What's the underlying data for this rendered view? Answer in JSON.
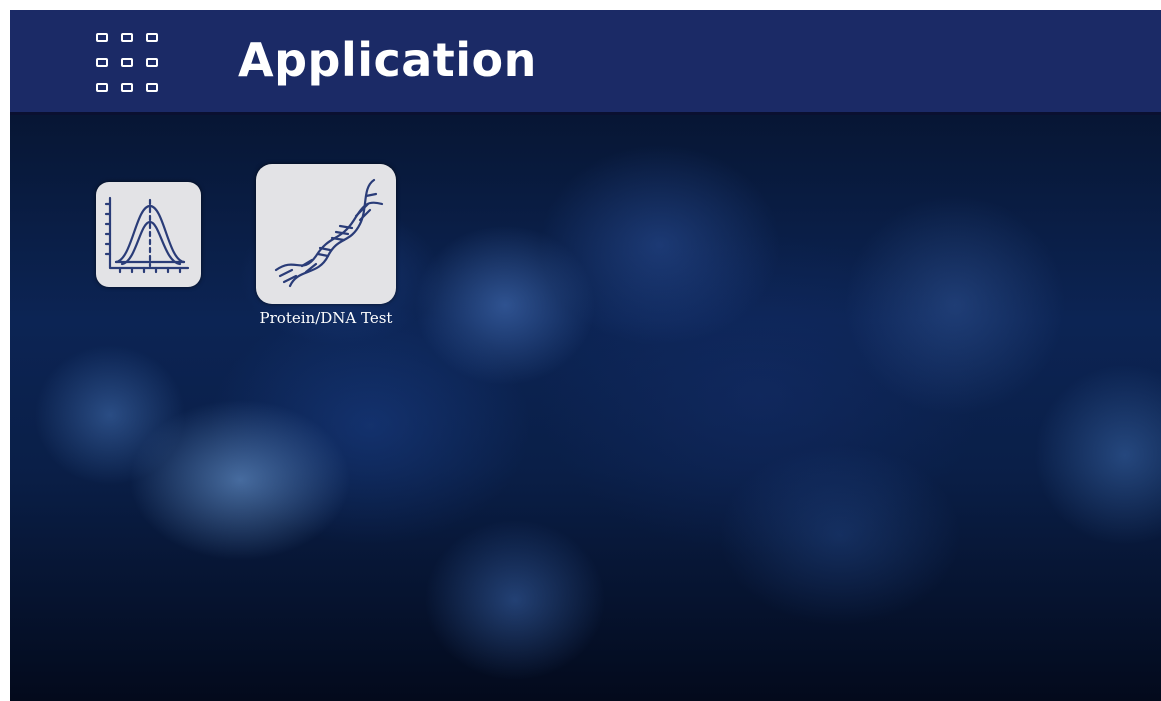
{
  "header": {
    "title": "Application",
    "menu_icon": "grid-menu-icon",
    "background_color": "#1b2a66"
  },
  "apps": [
    {
      "label": "",
      "icon": "gaussian-curve-icon"
    },
    {
      "label": "Protein/DNA Test",
      "icon": "dna-helix-icon"
    }
  ],
  "colors": {
    "tile_background": "#e3e3e6",
    "icon_stroke": "#2a3c78",
    "label_text": "#ffffff"
  }
}
